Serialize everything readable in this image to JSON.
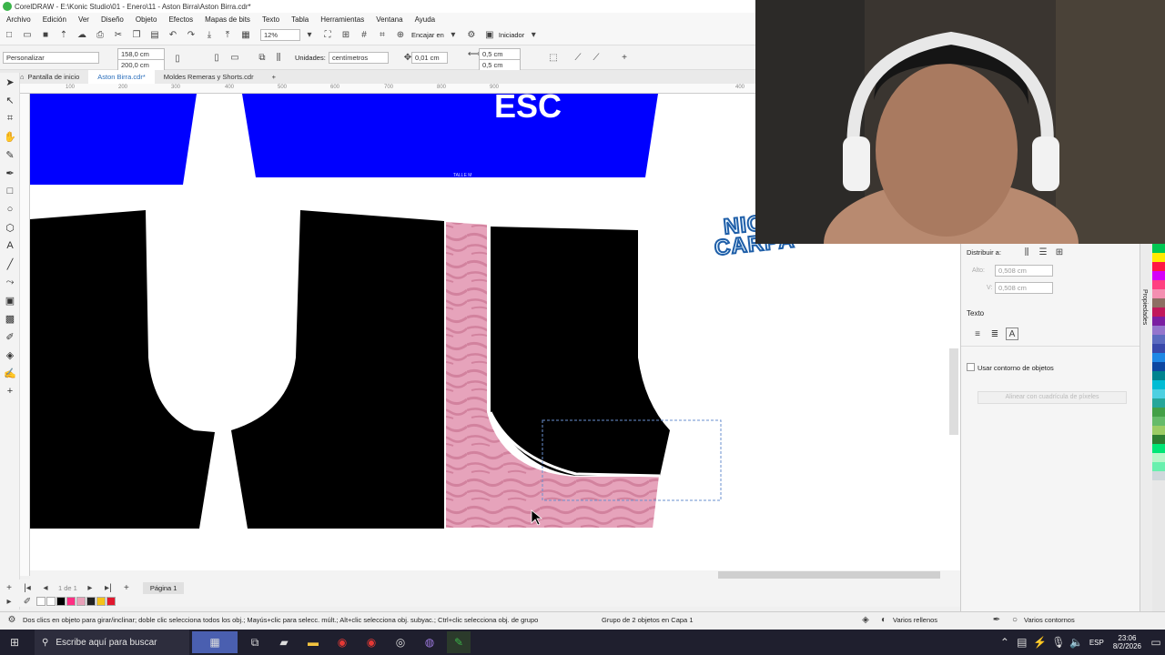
{
  "window": {
    "title": "CorelDRAW - E:\\Konic Studio\\01 - Enero\\11 - Aston Birra\\Aston Birra.cdr*"
  },
  "menu": [
    "Archivo",
    "Edición",
    "Ver",
    "Diseño",
    "Objeto",
    "Efectos",
    "Mapas de bits",
    "Texto",
    "Tabla",
    "Herramientas",
    "Ventana",
    "Ayuda"
  ],
  "toolbar": {
    "zoom": "12%",
    "snap_label": "Encajar en",
    "launcher_label": "Iniciador"
  },
  "propertybar": {
    "preset": "Personalizar",
    "width": "158,0 cm",
    "height": "200,0 cm",
    "units_label": "Unidades:",
    "units_value": "centímetros",
    "nudge": "0,01 cm",
    "dup_x": "0,5 cm",
    "dup_y": "0,5 cm"
  },
  "tabs": [
    {
      "label": "Pantalla de inicio"
    },
    {
      "label": "Aston Birra.cdr*"
    },
    {
      "label": "Moldes Remeras y Shorts.cdr"
    }
  ],
  "ruler": {
    "ticks": [
      "100",
      "200",
      "300",
      "400",
      "500",
      "600",
      "700",
      "800",
      "900",
      "400"
    ]
  },
  "canvas": {
    "banner_text": "ESC",
    "small_label": "TALLE M",
    "logo_line1": "NICO",
    "logo_line2": "CARPA"
  },
  "pagebar": {
    "count": "1 de 1",
    "page": "Página 1"
  },
  "status": {
    "hint": "Dos clics en objeto para girar/inclinar; doble clic selecciona todos los obj.; Mayús+clic para selecc. múlt.; Alt+clic selecciona obj. subyac.; Ctrl+clic selecciona obj. de grupo",
    "selection": "Grupo de 2 objetos en Capa 1",
    "fill": "Varios rellenos",
    "outline": "Varios contornos"
  },
  "props": {
    "distribute_label": "Distribuir a:",
    "alto_label": "Alto:",
    "alto_value": "0,508 cm",
    "v_label": "V:",
    "v_value": "0,508 cm",
    "text_section": "Texto",
    "use_outline": "Usar contorno de objetos",
    "align_btn": "Alinear con cuadrícula de píxeles",
    "side_tab": "Propiedades"
  },
  "taskbar": {
    "search_placeholder": "Escribe aquí para buscar",
    "lang": "ESP",
    "time": "23:06",
    "date": "8/2/2026"
  },
  "colors": {
    "blue": "#0000ff",
    "pink": "#e8a0b8",
    "black": "#000000"
  }
}
